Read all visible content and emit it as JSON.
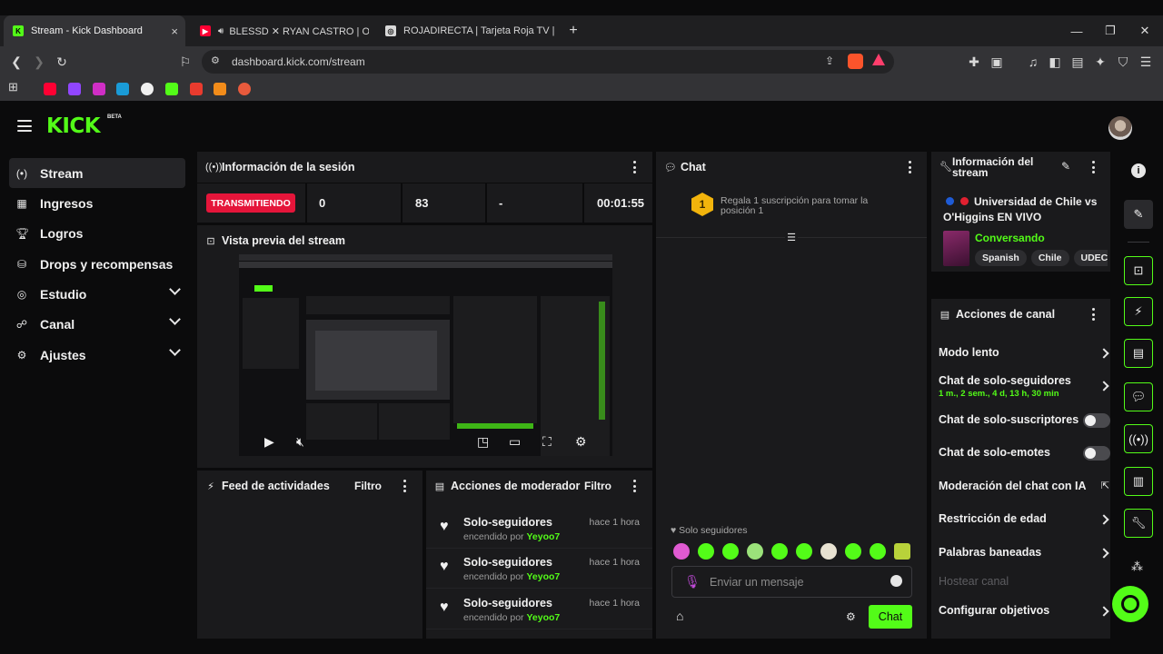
{
  "browser": {
    "tabs": [
      {
        "label": "Stream - Kick Dashboard",
        "close": "×"
      },
      {
        "label": "BLESSD ✕ RYAN CASTRO | OJITO"
      },
      {
        "label": "ROJADIRECTA | Tarjeta Roja TV | Fútbol"
      }
    ],
    "new_tab": "+",
    "window_controls": {
      "minimize": "—",
      "restore": "❐",
      "close": "✕"
    },
    "url": "dashboard.kick.com/stream"
  },
  "app": {
    "logo": "KICK",
    "beta": "BETA",
    "nav": [
      {
        "label": "Stream",
        "icon": "broadcast-icon"
      },
      {
        "label": "Ingresos",
        "icon": "chart-icon"
      },
      {
        "label": "Logros",
        "icon": "trophy-icon"
      },
      {
        "label": "Drops y recompensas",
        "icon": "drops-icon"
      },
      {
        "label": "Estudio",
        "icon": "studio-icon"
      },
      {
        "label": "Canal",
        "icon": "channel-icon"
      },
      {
        "label": "Ajustes",
        "icon": "gear-icon"
      }
    ],
    "session": {
      "title": "Información de la sesión",
      "status": "TRANSMITIENDO",
      "stat1": "0",
      "stat2": "83",
      "stat3": "-",
      "duration": "00:01:55"
    },
    "preview": {
      "title": "Vista previa del stream"
    },
    "feed": {
      "title": "Feed de actividades",
      "filter": "Filtro"
    },
    "mod": {
      "title": "Acciones de moderador",
      "filter": "Filtro",
      "rows": [
        {
          "action": "Solo-seguidores",
          "by_prefix": "encendido por",
          "user": "Yeyoo7",
          "when": "hace 1 hora"
        },
        {
          "action": "Solo-seguidores",
          "by_prefix": "encendido por",
          "user": "Yeyoo7",
          "when": "hace 1 hora"
        },
        {
          "action": "Solo-seguidores",
          "by_prefix": "encendido por",
          "user": "Yeyoo7",
          "when": "hace 1 hora"
        }
      ]
    },
    "chat": {
      "title": "Chat",
      "sub_rank": "1",
      "sub_text": "Regala 1 suscripción para tomar la posición 1",
      "followers_only": "Solo seguidores",
      "placeholder": "Enviar un mensaje",
      "send": "Chat"
    },
    "info": {
      "title": "Información del stream",
      "stream_title": "Universidad de Chile vs O'Higgins EN VIVO",
      "category": "Conversando",
      "tags": [
        "Spanish",
        "Chile",
        "UDEC"
      ]
    },
    "actions": {
      "title": "Acciones de canal",
      "items": [
        {
          "label": "Modo lento",
          "control": "chevron"
        },
        {
          "label": "Chat de solo-seguidores",
          "sub": "1 m., 2 sem., 4 d, 13 h, 30 min",
          "control": "chevron"
        },
        {
          "label": "Chat de solo-suscriptores",
          "control": "toggle"
        },
        {
          "label": "Chat de solo-emotes",
          "control": "toggle"
        },
        {
          "label": "Moderación del chat con IA",
          "control": "external"
        },
        {
          "label": "Restricción de edad",
          "control": "chevron"
        },
        {
          "label": "Palabras baneadas",
          "control": "chevron"
        },
        {
          "label": "Hostear canal",
          "control": "none"
        },
        {
          "label": "Configurar objetivos",
          "control": "chevron"
        }
      ]
    },
    "colors": {
      "brand": "#53fc18",
      "live": "#e5153a",
      "panel": "#1a1a1c"
    }
  }
}
